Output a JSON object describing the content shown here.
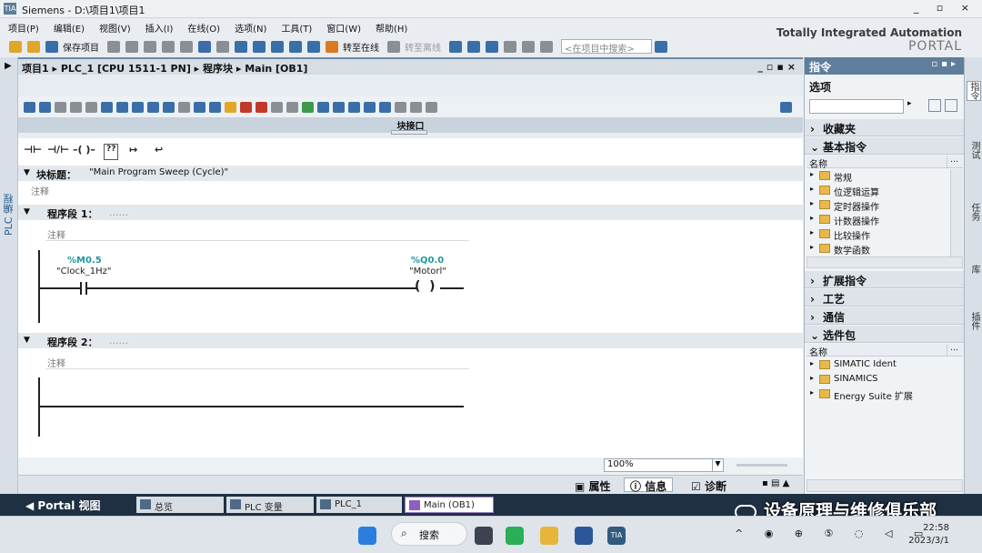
{
  "window": {
    "title": "Siemens  -  D:\\项目1\\项目1",
    "logo": "TIA"
  },
  "brand": {
    "line1": "Totally Integrated Automation",
    "line2": "PORTAL"
  },
  "menu": [
    "项目(P)",
    "编辑(E)",
    "视图(V)",
    "插入(I)",
    "在线(O)",
    "选项(N)",
    "工具(T)",
    "窗口(W)",
    "帮助(H)"
  ],
  "toolbar": {
    "save_label": "保存项目",
    "go_online": "转至在线",
    "go_offline": "转至离线",
    "search_placeholder": "<在项目中搜索>"
  },
  "editor": {
    "breadcrumb": "项目1 ▸ PLC_1 [CPU 1511-1 PN] ▸ 程序块 ▸ Main [OB1]",
    "interface_label": "块接口",
    "favorites": [
      "⊣⊢",
      "⊣/⊢",
      "–( )–",
      "??",
      "↦",
      "↩"
    ],
    "block_title_label": "块标题：",
    "block_title_value": "\"Main Program Sweep (Cycle)\"",
    "block_comment": "注释",
    "networks": [
      {
        "title": "程序段 1：",
        "dots": "......",
        "comment": "注释",
        "contact_addr": "%M0.5",
        "contact_name": "\"Clock_1Hz\"",
        "coil_addr": "%Q0.0",
        "coil_name": "\"Motorl\""
      },
      {
        "title": "程序段 2：",
        "dots": "......",
        "comment": "注释"
      }
    ],
    "zoom": "100%"
  },
  "inspector_tabs": {
    "properties": "属性",
    "info": "信息",
    "diagnostics": "诊断"
  },
  "task_panel": {
    "title": "指令",
    "options": "选项",
    "favorites": "收藏夹",
    "basic": "基本指令",
    "col_name": "名称",
    "basic_items": [
      "常规",
      "位逻辑运算",
      "定时器操作",
      "计数器操作",
      "比较操作",
      "数学函数"
    ],
    "extended": "扩展指令",
    "tech": "工艺",
    "comm": "通信",
    "optional": "选件包",
    "optional_items": [
      "SIMATIC Ident",
      "SINAMICS",
      "Energy Suite 扩展"
    ]
  },
  "side_tabs": [
    "指令",
    "测试",
    "任务",
    "库",
    "插件"
  ],
  "portal_bar": {
    "portal_view": "Portal 视图",
    "tabs": [
      "总览",
      "PLC 变量",
      "PLC_1",
      "Main (OB1)"
    ]
  },
  "watermark": "设备原理与维修俱乐部",
  "taskbar": {
    "search": "搜索",
    "time": "22:58",
    "date": "2023/3/1"
  },
  "colors": {
    "accent": "#5f7e9c",
    "operand": "#1e9aa0",
    "portal_bar": "#1f3043",
    "active_tab": "#8c5fc0"
  }
}
